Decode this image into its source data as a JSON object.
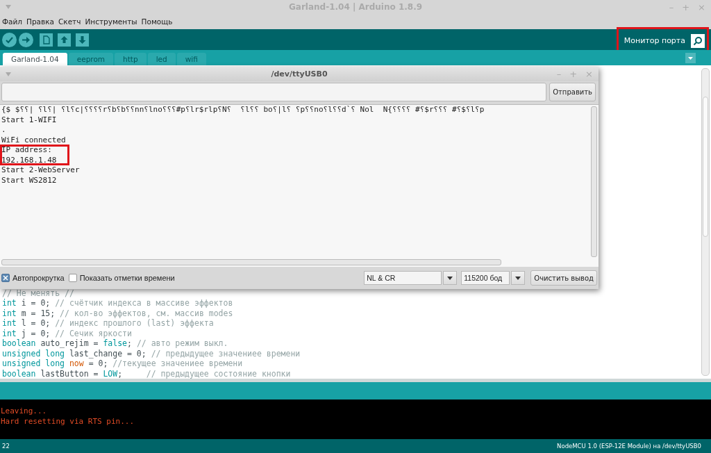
{
  "window": {
    "title": "Garland-1.04 | Arduino 1.8.9",
    "controls": [
      "–",
      "+",
      "×"
    ]
  },
  "menu": [
    "Файл",
    "Правка",
    "Скетч",
    "Инструменты",
    "Помощь"
  ],
  "toolbar": {
    "monitor_label": "Монитор порта"
  },
  "tabs": [
    {
      "label": "Garland-1.04",
      "selected": true
    },
    {
      "label": "eeprom",
      "selected": false
    },
    {
      "label": "http",
      "selected": false
    },
    {
      "label": "led",
      "selected": false
    },
    {
      "label": "wifi",
      "selected": false
    }
  ],
  "serial_monitor": {
    "title": "/dev/ttyUSB0",
    "controls": [
      "–",
      "+",
      "×"
    ],
    "send_button": "Отправить",
    "output": [
      "{$ $⸮⸮| ⸮l⸮| ⸮l⸮c|⸮⸮⸮⸮r⸮b⸮b⸮⸮nn⸮lno⸮⸮⸮#p⸮lr$rlp⸮N⸮  ⸮l⸮⸮ bo⸮|l⸮ ⸮p⸮⸮no⸮l⸮⸮d`⸮ Nol  N{⸮⸮⸮⸮ #⸮$r⸮⸮⸮ #⸮$⸮l⸮p",
      "Start 1-WIFI",
      ".",
      "WiFi connected",
      "IP address:",
      "192.168.1.48",
      "Start 2-WebServer",
      "Start WS2812"
    ],
    "options": [
      {
        "label": "Автопрокрутка",
        "checked": true
      },
      {
        "label": "Показать отметки времени",
        "checked": false
      }
    ],
    "line_ending": "NL & CR",
    "baud": "115200 бод",
    "clear_button": "Очистить вывод"
  },
  "code": [
    [
      {
        "kind": "comment",
        "text": "// Не менять //"
      }
    ],
    [
      {
        "kind": "type",
        "text": "int"
      },
      {
        "kind": "plain",
        "text": " i = 0; "
      },
      {
        "kind": "comment",
        "text": "// счётчик индекса в массиве эффектов"
      }
    ],
    [
      {
        "kind": "type",
        "text": "int"
      },
      {
        "kind": "plain",
        "text": " m = 15; "
      },
      {
        "kind": "comment",
        "text": "// кол-во эффектов, см. массив modes"
      }
    ],
    [
      {
        "kind": "type",
        "text": "int"
      },
      {
        "kind": "plain",
        "text": " l = 0; "
      },
      {
        "kind": "comment",
        "text": "// индекс прошлого (last) эффекта"
      }
    ],
    [
      {
        "kind": "type",
        "text": "int"
      },
      {
        "kind": "plain",
        "text": " j = 0; "
      },
      {
        "kind": "comment",
        "text": "// Сечик яркости"
      }
    ],
    [
      {
        "kind": "type",
        "text": "boolean"
      },
      {
        "kind": "plain",
        "text": " auto_rejim = "
      },
      {
        "kind": "literal",
        "text": "false"
      },
      {
        "kind": "plain",
        "text": "; "
      },
      {
        "kind": "comment",
        "text": "// авто режим выкл."
      }
    ],
    [
      {
        "kind": "type",
        "text": "unsigned long"
      },
      {
        "kind": "plain",
        "text": " last_change = 0; "
      },
      {
        "kind": "comment",
        "text": "// предыдущее значениее времени"
      }
    ],
    [
      {
        "kind": "type",
        "text": "unsigned long "
      },
      {
        "kind": "function",
        "text": "now"
      },
      {
        "kind": "plain",
        "text": " = 0; "
      },
      {
        "kind": "comment",
        "text": "//текущее значениее времени"
      }
    ],
    [
      {
        "kind": "type",
        "text": "boolean"
      },
      {
        "kind": "plain",
        "text": " lastButton = "
      },
      {
        "kind": "literal",
        "text": "LOW"
      },
      {
        "kind": "plain",
        "text": ";     "
      },
      {
        "kind": "comment",
        "text": "// предыдущее состояние кнопки"
      }
    ]
  ],
  "console": [
    "Leaving...",
    "Hard resetting via RTS pin..."
  ],
  "status_bar": {
    "line": "22",
    "board": "NodeMCU 1.0 (ESP-12E Module) на /dev/ttyUSB0"
  }
}
